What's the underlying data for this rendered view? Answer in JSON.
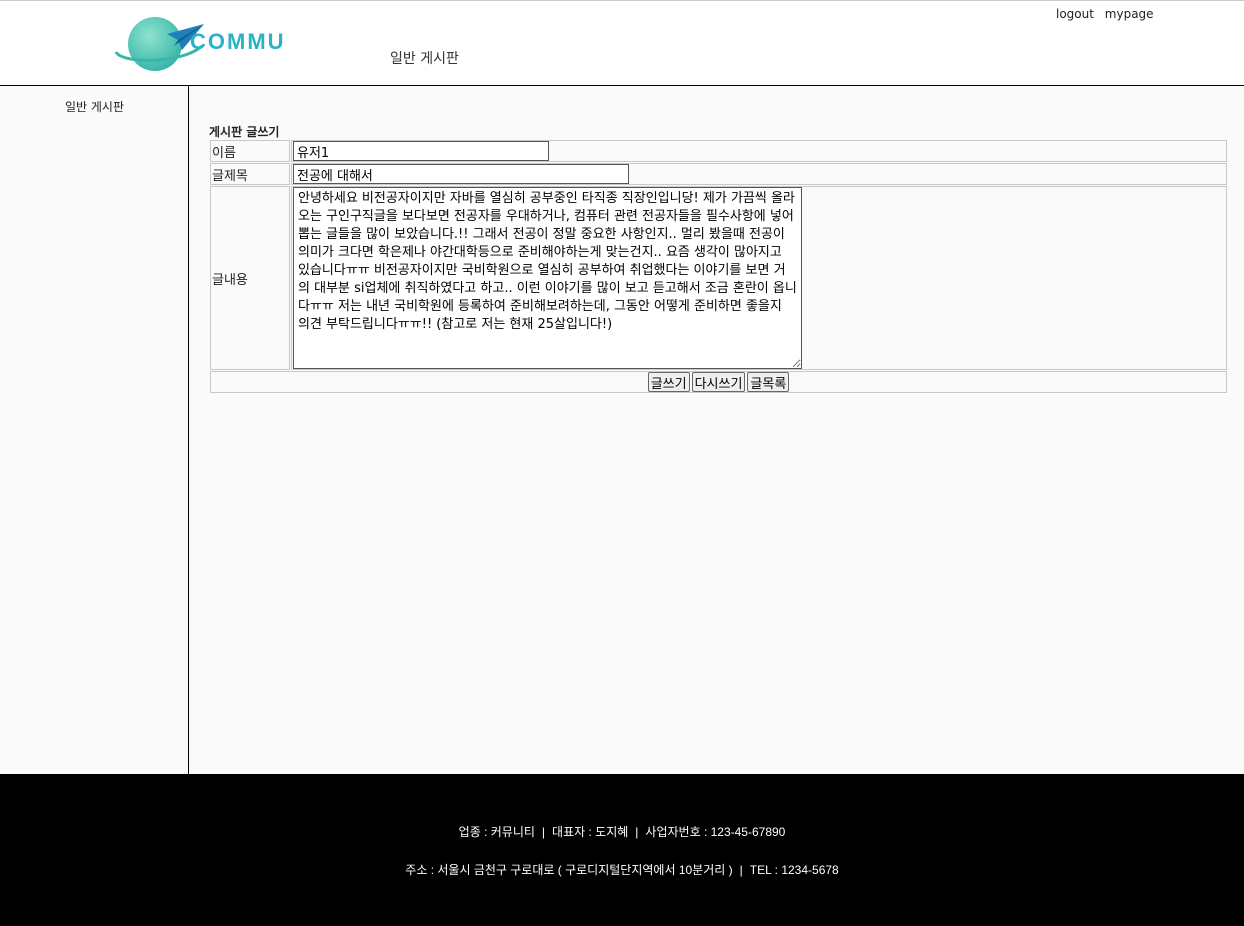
{
  "header": {
    "logo_text": "COMMU",
    "nav_title": "일반 게시판",
    "links": [
      "logout",
      "mypage"
    ]
  },
  "sidebar": {
    "items": [
      {
        "label": "일반 게시판"
      }
    ]
  },
  "form": {
    "title": "게시판 글쓰기",
    "name_label": "이름",
    "name_value": "유저1",
    "subject_label": "글제목",
    "subject_value": "전공에 대해서",
    "content_label": "글내용",
    "content_value": "안녕하세요 비전공자이지만 자바를 열심히 공부중인 타직종 직장인입니당! 제가 가끔씩 올라오는 구인구직글을 보다보면 전공자를 우대하거나, 컴퓨터 관련 전공자들을 필수사항에 넣어 뽑는 글들을 많이 보았습니다.!! 그래서 전공이 정말 중요한 사항인지.. 멀리 봤을때 전공이 의미가 크다면 학은제나 야간대학등으로 준비해야하는게 맞는건지.. 요즘 생각이 많아지고 있습니다ㅠㅠ 비전공자이지만 국비학원으로 열심히 공부하여 취업했다는 이야기를 보면 거의 대부분 si업체에 취직하였다고 하고.. 이런 이야기를 많이 보고 듣고해서 조금 혼란이 옵니다ㅠㅠ 저는 내년 국비학원에 등록하여 준비해보려하는데, 그동안 어떻게 준비하면 좋을지 의견 부탁드립니다ㅠㅠ!! (참고로 저는 현재 25살입니다!)",
    "buttons": {
      "submit": "글쓰기",
      "reset": "다시쓰기",
      "list": "글목록"
    }
  },
  "footer": {
    "business_type": "업종 : 커뮤니티",
    "representative": "대표자 : 도지혜",
    "business_number": "사업자번호 : 123-45-67890",
    "address": "주소 : 서울시 금천구 구로대로 ( 구로디지털단지역에서 10분거리 )",
    "tel": "TEL : 1234-5678",
    "separator": "|"
  },
  "colors": {
    "logo_teal": "#2bb3c4",
    "logo_circle": "#6fd3c0",
    "plane_blue": "#1f7fb8",
    "footer_bg": "#000000"
  }
}
